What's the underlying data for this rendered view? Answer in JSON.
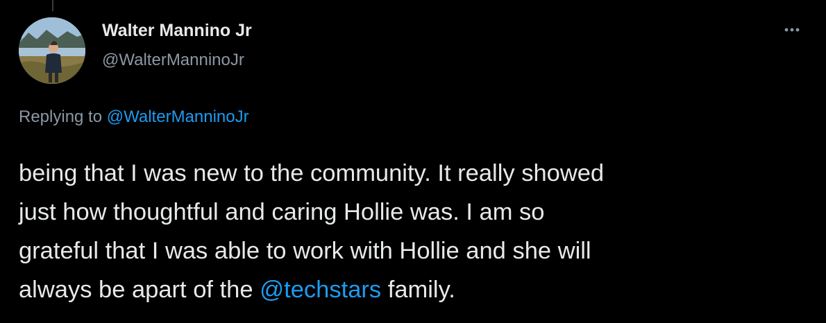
{
  "author": {
    "name": "Walter Mannino Jr",
    "handle": "@WalterManninoJr",
    "avatar_icon": "profile-photo-person-lake-mountains"
  },
  "menu": {
    "icon": "more-horizontal-icon"
  },
  "reply": {
    "prefix": "Replying to",
    "mention": "@WalterManninoJr"
  },
  "tweet": {
    "lines": [
      "being that I was new to the community. It really showed",
      "just how thoughtful and caring Hollie was. I am so",
      "grateful that I was able to work with Hollie and she will"
    ],
    "last_line_before": "always be apart of the",
    "mention": "@techstars",
    "last_line_after": "family."
  },
  "colors": {
    "background": "#000000",
    "text": "#e7e9ea",
    "secondary": "#8b98a5",
    "accent": "#1d9bf0"
  }
}
